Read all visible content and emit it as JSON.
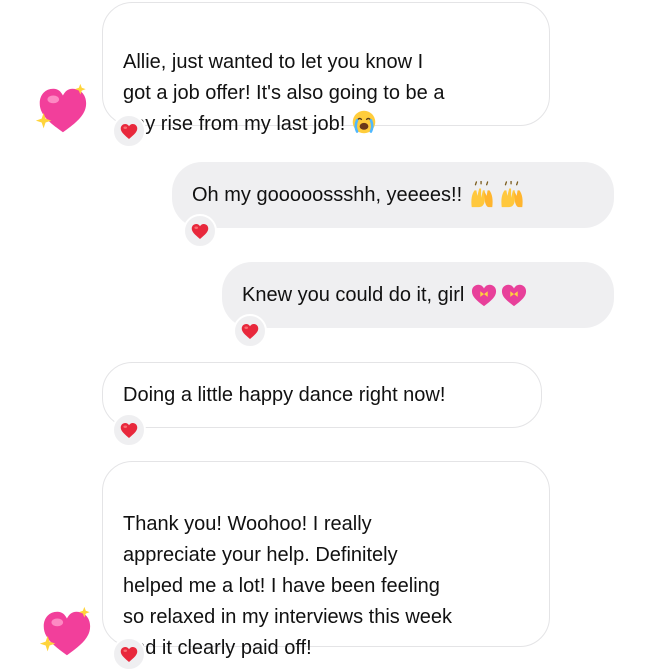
{
  "colors": {
    "incoming_bubble": "#ffffff",
    "incoming_border": "#e4e4e6",
    "outgoing_bubble": "#efeff1",
    "reaction_heart": "#e8283c",
    "sparkle_heart": "#f23f9b"
  },
  "messages": [
    {
      "direction": "incoming",
      "text": "Allie, just wanted to let you know I\ngot a job offer! It's also going to be a\npay rise from my last job!",
      "trailing_emoji": "loudly-crying-face-emoji",
      "reaction": "red-heart",
      "avatar": "sparkling-heart-emoji"
    },
    {
      "direction": "outgoing",
      "text": "Oh my gooooossshh, yeeees!!",
      "trailing_emoji": "raising-hands-emoji x2",
      "reaction": "red-heart"
    },
    {
      "direction": "outgoing",
      "text": "Knew you could do it, girl",
      "trailing_emoji": "heart-with-ribbon-emoji x2",
      "reaction": "red-heart"
    },
    {
      "direction": "incoming",
      "text": "Doing a little happy dance right now!",
      "reaction": "red-heart"
    },
    {
      "direction": "incoming",
      "text": "Thank you! Woohoo! I really\nappreciate your help. Definitely\nhelped me a lot! I have been feeling\nso relaxed in my interviews this week\nand it clearly paid off!",
      "reaction": "red-heart",
      "avatar": "sparkling-heart-emoji"
    }
  ]
}
